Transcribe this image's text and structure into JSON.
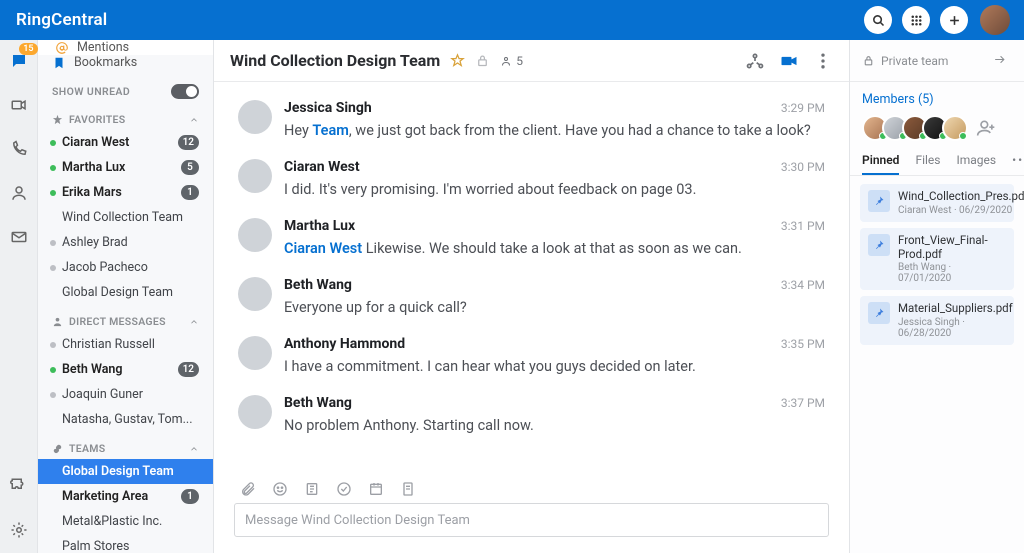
{
  "header": {
    "brand": "RingCentral"
  },
  "rail": {
    "badge": "15"
  },
  "sidebar": {
    "mentions": "Mentions",
    "bookmarks": "Bookmarks",
    "show_unread": "SHOW UNREAD",
    "favorites_hdr": "FAVORITES",
    "dm_hdr": "DIRECT MESSAGES",
    "teams_hdr": "TEAMS",
    "favorites": [
      {
        "name": "Ciaran West",
        "bold": true,
        "presence": "green",
        "badge": "12"
      },
      {
        "name": "Martha Lux",
        "bold": true,
        "presence": "green",
        "badge": "5"
      },
      {
        "name": "Erika Mars",
        "bold": true,
        "presence": "green",
        "badge": "1"
      },
      {
        "name": "Wind Collection Team"
      },
      {
        "name": "Ashley Brad",
        "presence": "gray"
      },
      {
        "name": "Jacob Pacheco",
        "presence": "gray"
      },
      {
        "name": "Global Design Team"
      }
    ],
    "dms": [
      {
        "name": "Christian Russell",
        "presence": "gray"
      },
      {
        "name": "Beth Wang",
        "bold": true,
        "presence": "green",
        "badge": "12"
      },
      {
        "name": "Joaquin Guner",
        "presence": "gray"
      },
      {
        "name": "Natasha, Gustav, Tom..."
      }
    ],
    "teams": [
      {
        "name": "Global Design Team",
        "selected": true
      },
      {
        "name": "Marketing Area",
        "bold": true,
        "badge": "1"
      },
      {
        "name": "Metal&Plastic Inc."
      },
      {
        "name": "Palm Stores"
      }
    ]
  },
  "chat": {
    "title": "Wind Collection Design Team",
    "member_count": "5",
    "messages": [
      {
        "name": "Jessica Singh",
        "time": "3:29 PM",
        "lead_mention": "Team",
        "prefix": "Hey ",
        "text": ", we just got back from the client. Have you had a chance to take a look?",
        "av": "av-a"
      },
      {
        "name": "Ciaran West",
        "time": "3:30 PM",
        "text": "I did. It's very promising. I'm worried about feedback on page 03.",
        "av": "av-b"
      },
      {
        "name": "Martha Lux",
        "time": "3:31 PM",
        "lead_mention": "Ciaran West",
        "text": " Likewise. We should take a look at that as soon as we can.",
        "av": "av-c"
      },
      {
        "name": "Beth Wang",
        "time": "3:34 PM",
        "text": "Everyone up for a quick call?",
        "av": "av-d"
      },
      {
        "name": "Anthony Hammond",
        "time": "3:35 PM",
        "text": "I have a commitment. I can hear what you guys decided on later.",
        "av": "av-e"
      },
      {
        "name": "Beth Wang",
        "time": "3:37 PM",
        "text": "No problem Anthony. Starting call now.",
        "av": "av-d"
      }
    ],
    "composer_placeholder": "Message Wind Collection Design Team"
  },
  "rpanel": {
    "privacy": "Private team",
    "members_label": "Members (5)",
    "tabs": {
      "pinned": "Pinned",
      "files": "Files",
      "images": "Images"
    },
    "pins": [
      {
        "file": "Wind_Collection_Pres.pdf",
        "meta": "Ciaran West · 06/29/2020"
      },
      {
        "file": "Front_View_Final-Prod.pdf",
        "meta": "Beth Wang · 07/01/2020"
      },
      {
        "file": "Material_Suppliers.pdf",
        "meta": "Jessica Singh · 06/28/2020"
      }
    ]
  }
}
